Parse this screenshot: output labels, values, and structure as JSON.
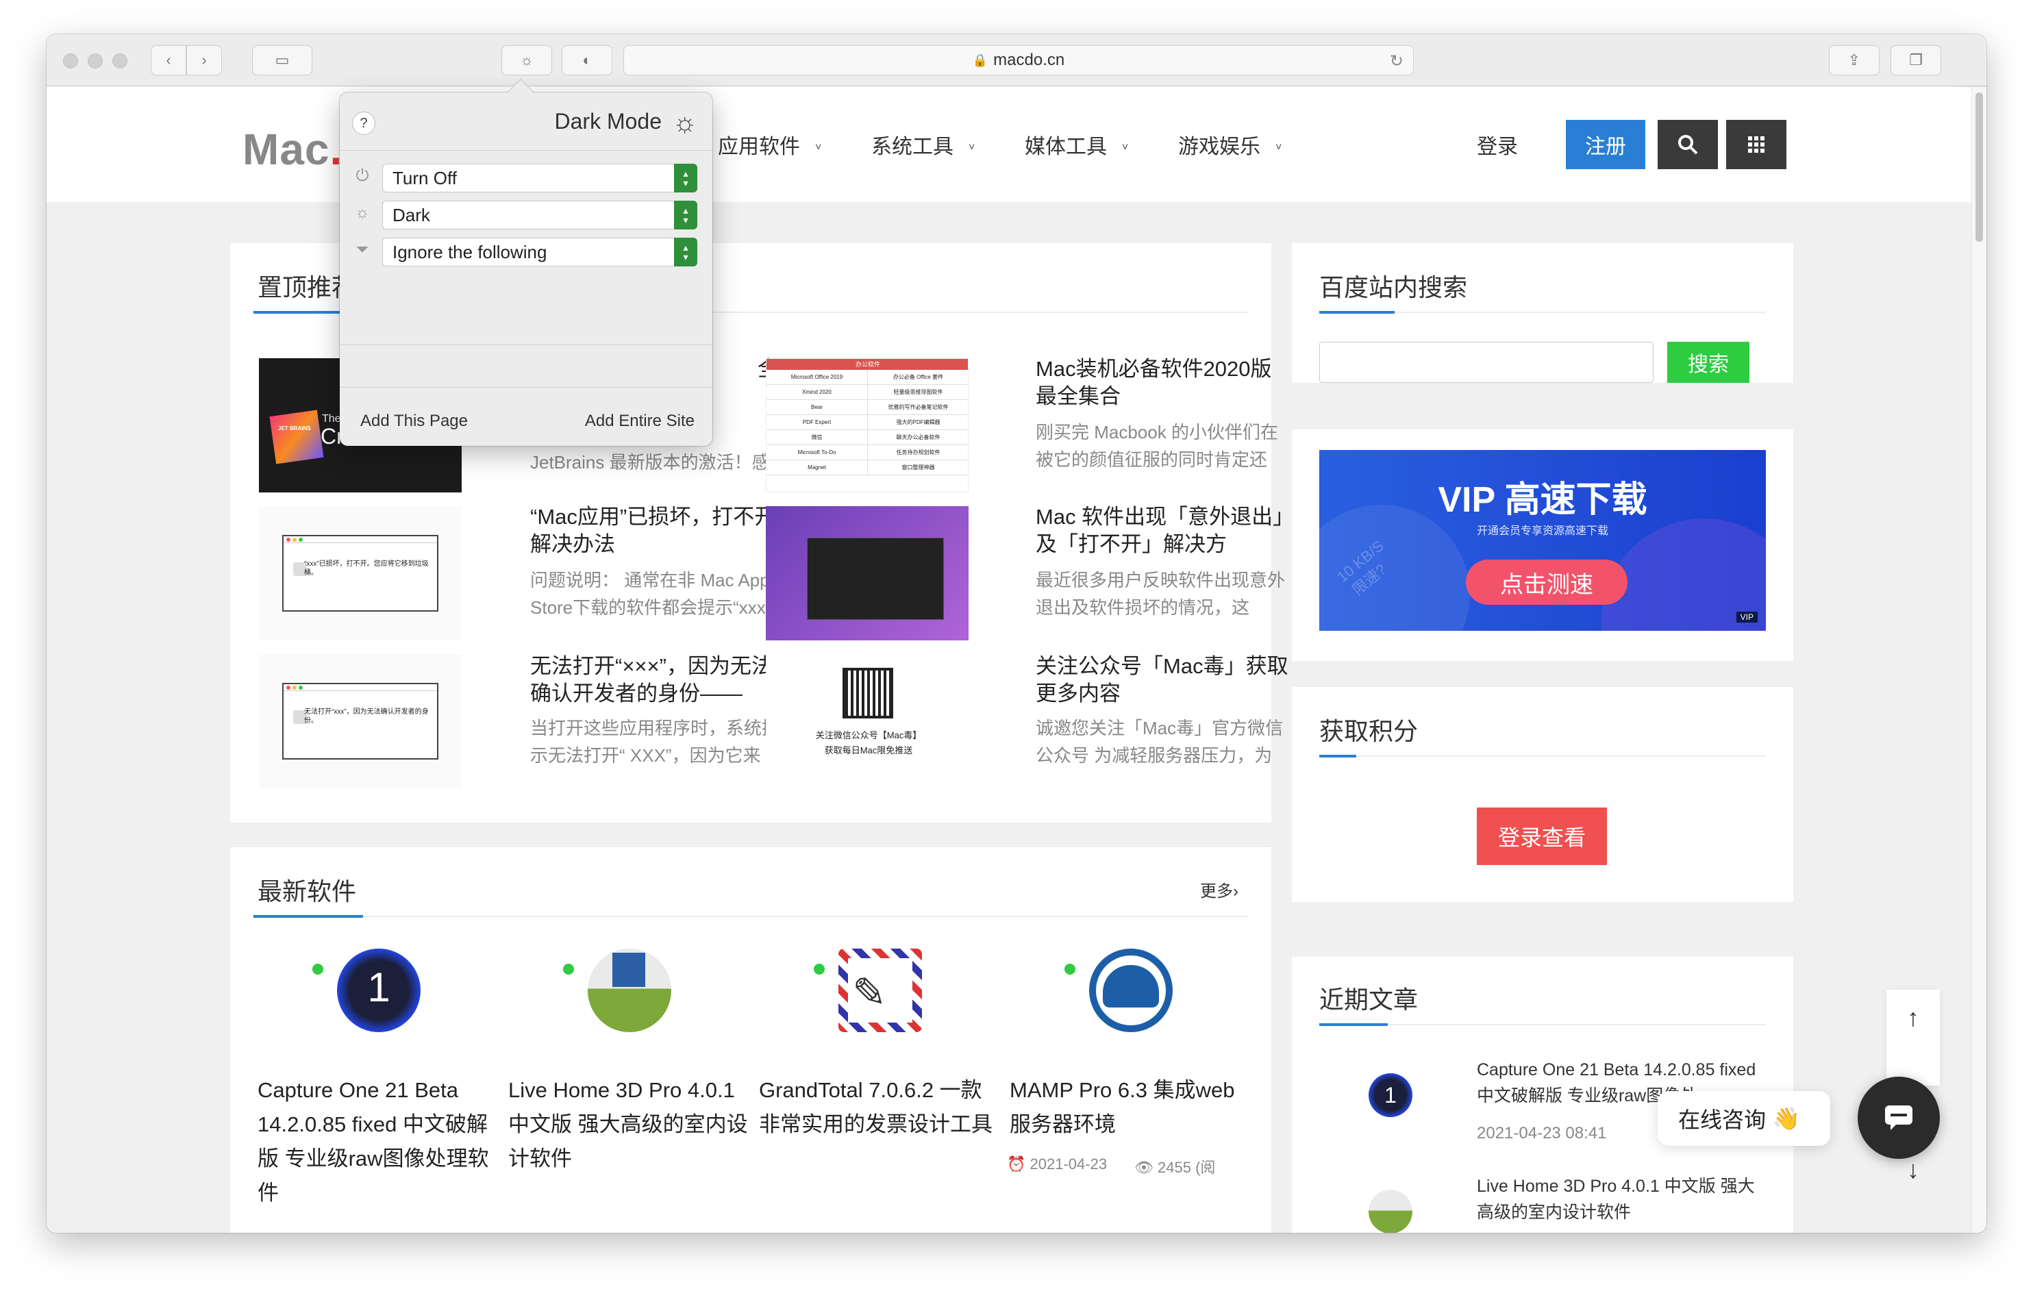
{
  "browser": {
    "address": "macdo.cn"
  },
  "site": {
    "logo": "Mac",
    "nav": [
      {
        "label": "应用软件"
      },
      {
        "label": "系统工具"
      },
      {
        "label": "媒体工具"
      },
      {
        "label": "游戏娱乐"
      }
    ],
    "login": "登录",
    "register": "注册"
  },
  "popup": {
    "help": "?",
    "title": "Dark Mode",
    "select_power": "Turn Off",
    "select_mode": "Dark",
    "select_filter": "Ignore the following",
    "add_page": "Add This Page",
    "add_site": "Add Entire Site"
  },
  "pinned": {
    "title": "置顶推荐",
    "articles": [
      {
        "title": "全",
        "desc": "JetBrains 最新版本的激活！感"
      },
      {
        "title": "Mac装机必备软件2020版最全集合",
        "desc": "刚买完 Macbook 的小伙伴们在被它的颜值征服的同时肯定还"
      },
      {
        "title": "“Mac应用”已损坏，打不开解决办法",
        "desc": "问题说明： 通常在非 Mac App Store下载的软件都会提示“xxx"
      },
      {
        "title": "Mac 软件出现「意外退出」及「打不开」解决方",
        "desc": "最近很多用户反映软件出现意外退出及软件损坏的情况，这"
      },
      {
        "title": "无法打开“×××”，因为无法确认开发者的身份——",
        "desc": "当打开这些应用程序时，系统提示无法打开“ XXX”，因为它来"
      },
      {
        "title": "关注公众号「Mac毒」获取更多内容",
        "desc": "诚邀您关注「Mac毒」官方微信公众号 为减轻服务器压力，为"
      }
    ],
    "thumb_texts": {
      "jetbrains_brand": "JET BRAINS",
      "jetbrains_the": "The",
      "jetbrains_cr": "Cr",
      "table_head": "办公软件",
      "table_rows": [
        [
          "Microsoft Office 2019",
          "办公必备 Office 套件"
        ],
        [
          "Xmind 2020",
          "轻量级思维导图软件"
        ],
        [
          "Bear",
          "优雅的写作必备笔记软件"
        ],
        [
          "PDF Expert",
          "强大的PDF编辑器"
        ],
        [
          "微信",
          "聊天办公必备软件"
        ],
        [
          "Microsoft To-Do",
          "任务待办规划软件"
        ],
        [
          "Magnet",
          "窗口整理神器"
        ]
      ],
      "damaged_dialog": "“xxx”已损坏，打不开。您应将它移到垃圾桶。",
      "unverified_dialog": "无法打开“xxx”，因为无法确认开发者的身份。",
      "qr_caption1": "关注微信公众号【Mac毒】",
      "qr_caption2": "获取每日Mac限免推送"
    }
  },
  "latest": {
    "title": "最新软件",
    "more": "更多›",
    "items": [
      {
        "title": "Capture One 21 Beta 14.2.0.85 fixed 中文破解版 专业级raw图像处理软件",
        "icon": "capture-one-icon"
      },
      {
        "title": "Live Home 3D Pro 4.0.1 中文版 强大高级的室内设计软件",
        "icon": "live-home-3d-icon"
      },
      {
        "title": "GrandTotal 7.0.6.2 一款非常实用的发票设计工具",
        "icon": "grandtotal-icon"
      },
      {
        "title": "MAMP Pro 6.3 集成web服务器环境",
        "icon": "mamp-icon",
        "date": "2021-04-23",
        "views": "2455 (阅"
      }
    ]
  },
  "sidebar": {
    "search_title": "百度站内搜索",
    "search_button": "搜索",
    "search_placeholder": "",
    "vip_title": "VIP 高速下载",
    "vip_sub": "开通会员专享资源高速下载",
    "vip_button": "点击测速",
    "vip_speed": "10 KB/S",
    "vip_slow": "限速?",
    "vip_badge": "VIP",
    "points_title": "获取积分",
    "points_button": "登录查看",
    "recent_title": "近期文章",
    "recent": [
      {
        "title": "Capture One 21 Beta 14.2.0.85 fixed 中文破解版 专业级raw图像处",
        "date": "2021-04-23 08:41"
      },
      {
        "title": "Live Home 3D Pro 4.0.1 中文版 强大高级的室内设计软件",
        "date": ""
      }
    ]
  },
  "chat": {
    "label": "在线咨询",
    "emoji": "👋"
  },
  "colors": {
    "accent": "#2a7fd4",
    "green": "#2ecc40",
    "red_button": "#f05050"
  }
}
